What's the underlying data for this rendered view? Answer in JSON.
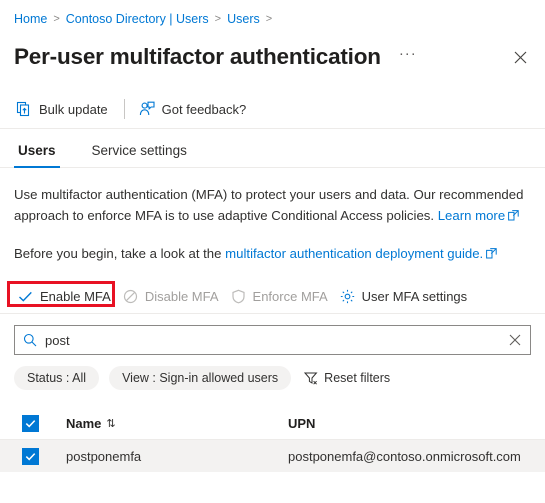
{
  "breadcrumb": {
    "items": [
      {
        "label": "Home"
      },
      {
        "label": "Contoso Directory | Users"
      },
      {
        "label": "Users"
      }
    ],
    "separator": ">"
  },
  "header": {
    "title": "Per-user multifactor authentication",
    "more_label": "···",
    "more_icon": "ellipsis-icon",
    "close_icon": "close-icon"
  },
  "command_bar": {
    "items": [
      {
        "label": "Bulk update",
        "icon": "bulk-update-icon"
      },
      {
        "label": "Got feedback?",
        "icon": "feedback-person-icon"
      }
    ]
  },
  "tabs": [
    {
      "label": "Users",
      "active": true
    },
    {
      "label": "Service settings",
      "active": false
    }
  ],
  "description": {
    "paragraph1_part1": "Use multifactor authentication (MFA) to protect your users and data. Our recommended approach to enforce MFA is to use adaptive Conditional Access policies. ",
    "paragraph1_link": "Learn more",
    "paragraph2_part1": "Before you begin, take a look at the ",
    "paragraph2_link": "multifactor authentication deployment guide.",
    "external_icon": "external-link-icon"
  },
  "actions": [
    {
      "label": "Enable MFA",
      "icon": "checkmark-icon",
      "disabled": false,
      "highlighted": true
    },
    {
      "label": "Disable MFA",
      "icon": "block-circle-icon",
      "disabled": true,
      "highlighted": false
    },
    {
      "label": "Enforce MFA",
      "icon": "shield-icon",
      "disabled": true,
      "highlighted": false
    },
    {
      "label": "User MFA settings",
      "icon": "gear-icon",
      "disabled": false,
      "highlighted": false
    }
  ],
  "search": {
    "value": "post",
    "placeholder": "Search",
    "search_icon": "search-icon",
    "clear_icon": "clear-icon"
  },
  "filters": {
    "chips": [
      {
        "label": "Status : All"
      },
      {
        "label": "View : Sign-in allowed users"
      }
    ],
    "reset_label": "Reset filters",
    "reset_icon": "filter-reset-icon"
  },
  "table": {
    "columns": [
      {
        "label": "Name",
        "sortable": true,
        "sort_glyph": "⇅"
      },
      {
        "label": "UPN",
        "sortable": false
      }
    ],
    "select_all_checked": true,
    "rows": [
      {
        "checked": true,
        "name": "postponemfa",
        "upn": "postponemfa@contoso.onmicrosoft.com"
      }
    ]
  },
  "colors": {
    "accent": "#0078d4",
    "highlight_red": "#e81123",
    "row_selected_bg": "#f3f2f1",
    "text_primary": "#323130",
    "text_disabled": "#a19f9d"
  }
}
